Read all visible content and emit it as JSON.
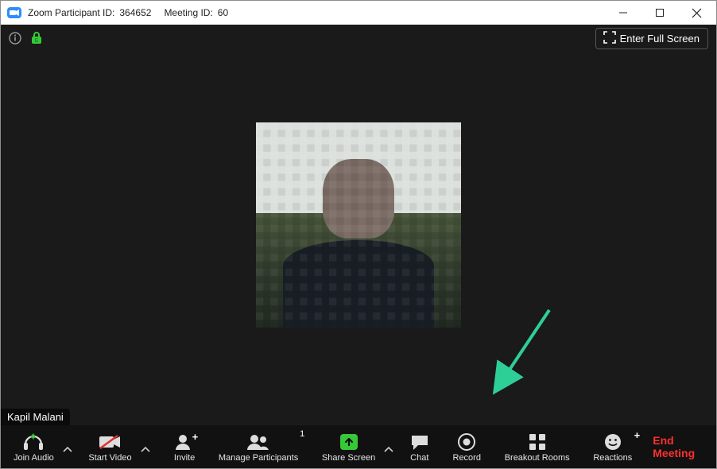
{
  "titlebar": {
    "participant_label": "Zoom Participant ID:",
    "participant_id": "364652",
    "meeting_label": "Meeting ID:",
    "meeting_id": "60"
  },
  "top": {
    "fullscreen_label": "Enter Full Screen"
  },
  "participant": {
    "name": "Kapil Malani"
  },
  "toolbar": {
    "join_audio": "Join Audio",
    "start_video": "Start Video",
    "invite": "Invite",
    "manage_participants": "Manage Participants",
    "participants_count": "1",
    "share_screen": "Share Screen",
    "chat": "Chat",
    "record": "Record",
    "breakout_rooms": "Breakout Rooms",
    "reactions": "Reactions",
    "end_meeting": "End Meeting"
  },
  "colors": {
    "accent_green": "#37c837",
    "arrow": "#2ecf96",
    "end_red": "#ff2f2f"
  }
}
